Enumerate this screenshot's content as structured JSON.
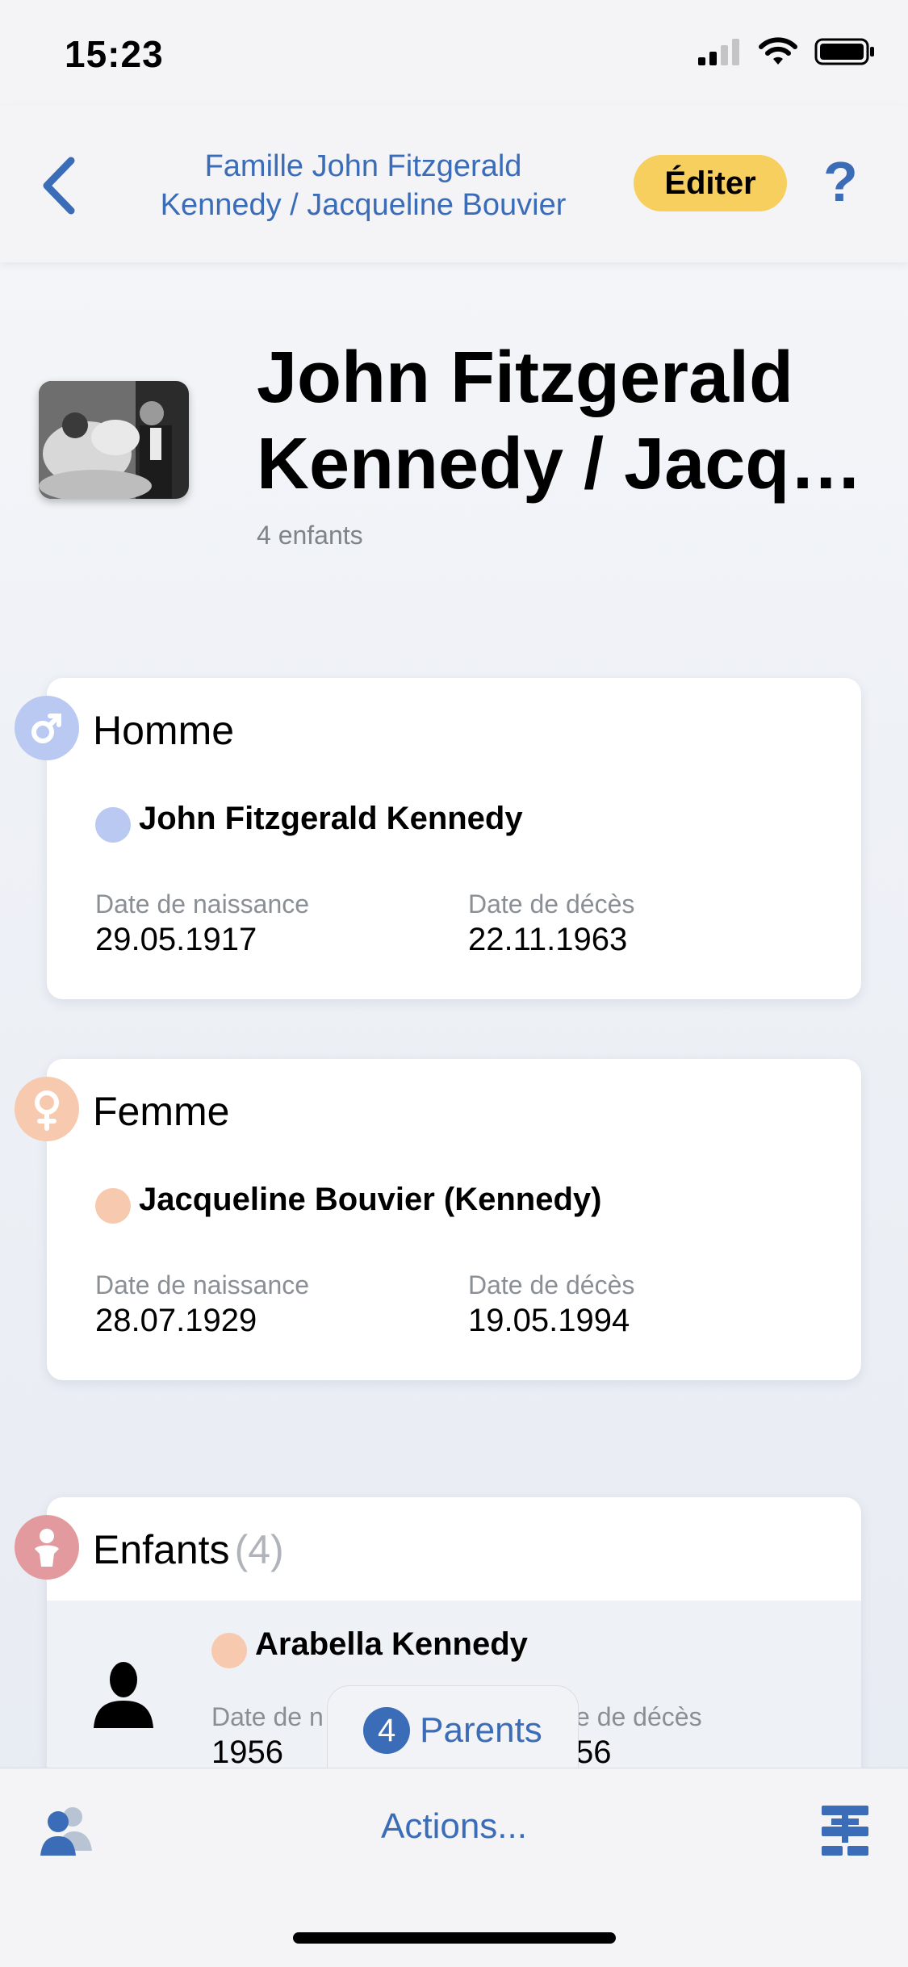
{
  "status": {
    "time": "15:23"
  },
  "nav": {
    "title_line1": "Famille John Fitzgerald",
    "title_line2": "Kennedy / Jacqueline Bouvier",
    "edit_label": "Éditer",
    "help_label": "?"
  },
  "header": {
    "title_line1": "John Fitzgerald",
    "title_line2": "Kennedy / Jacqu…",
    "subtitle": "4 enfants"
  },
  "man": {
    "heading": "Homme",
    "name": "John Fitzgerald Kennedy",
    "birth_label": "Date de naissance",
    "birth_value": "29.05.1917",
    "death_label": "Date de décès",
    "death_value": "22.11.1963"
  },
  "woman": {
    "heading": "Femme",
    "name": "Jacqueline Bouvier (Kennedy)",
    "birth_label": "Date de naissance",
    "birth_value": "28.07.1929",
    "death_label": "Date de décès",
    "death_value": "19.05.1994"
  },
  "children": {
    "heading": "Enfants",
    "count": "(4)",
    "first": {
      "name": "Arabella Kennedy",
      "birth_label": "Date de n",
      "birth_value": "1956",
      "death_label": "e de décès",
      "death_value": "56"
    }
  },
  "parents_pill": {
    "count": "4",
    "label": "Parents"
  },
  "bottom": {
    "actions_label": "Actions..."
  },
  "colors": {
    "accent": "#3b6cb8",
    "edit": "#f6cf5f",
    "male": "#b9c9f2",
    "female": "#f7c9ae",
    "children": "#e39a9e"
  }
}
